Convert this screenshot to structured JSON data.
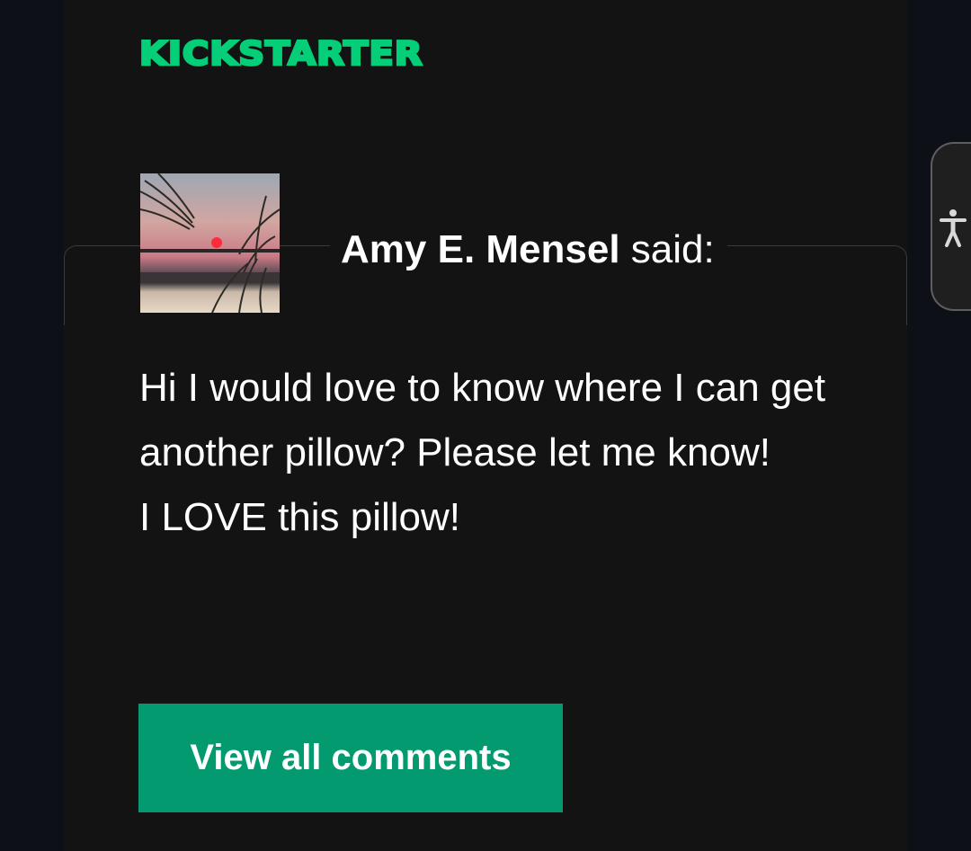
{
  "header": {
    "logo_text": "KICKSTARTER",
    "logo_color": "#05ce78"
  },
  "comment": {
    "author_name": "Amy E. Mensel",
    "said_label": "said:",
    "avatar_icon": "sunset-photo-avatar",
    "body_lines": [
      "Hi I would love to know where I can get another pillow? Please let me know!",
      "I LOVE this pillow!"
    ]
  },
  "actions": {
    "view_all_label": "View all comments",
    "button_color": "#049a6f"
  },
  "accessibility": {
    "icon": "accessibility-person-icon"
  },
  "colors": {
    "page_background": "#0d1117",
    "card_background": "#131313",
    "text": "#ffffff"
  }
}
